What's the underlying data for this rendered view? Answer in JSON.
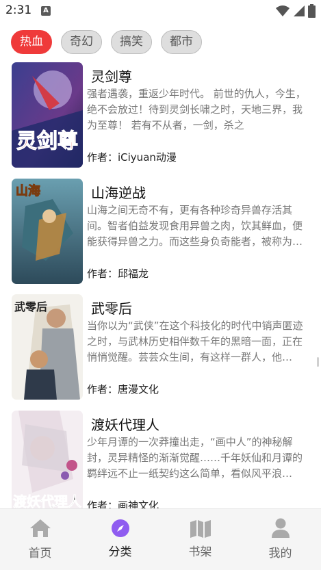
{
  "status_bar": {
    "time": "2:31",
    "notification_badge": "A"
  },
  "categories": [
    {
      "label": "热血",
      "active": true
    },
    {
      "label": "奇幻",
      "active": false
    },
    {
      "label": "搞笑",
      "active": false
    },
    {
      "label": "都市",
      "active": false
    }
  ],
  "comics": [
    {
      "title": "灵剑尊",
      "description": "强者遇袭，重返少年时代。 前世的仇人，今生，绝不会放过！待到灵剑长啸之时，天地三界，我为至尊！ 若有不从者，一剑，杀之",
      "author": "作者：iCiyuan动漫",
      "cover_text": "灵剑尊"
    },
    {
      "title": "山海逆战",
      "description": "山海之间无奇不有，更有各种珍奇异兽存活其间。智者伯益发现食用异兽之肉，饮其鲜血，便能获得异兽之力。而这些身负奇能者，被称为御兽师……",
      "author": "作者：邱福龙",
      "cover_text": "山海"
    },
    {
      "title": "武零后",
      "description": "当你以为“武侠”在这个科技化的时代中销声匿迹之时，与武林历史相伴数千年的黑暗一面，正在悄悄觉醒。芸芸众生间，有这样一群人，他们……",
      "author": "作者：唐漫文化",
      "cover_text": "武零后"
    },
    {
      "title": "渡妖代理人",
      "description": "少年月谭的一次莽撞出走，“画中人”的神秘解封，灵异精怪的渐渐觉醒……千年妖仙和月谭的羁绊远不止一纸契约这么简单，看似风平浪静……",
      "author": "作者：画神文化",
      "cover_text": "渡妖代理人"
    }
  ],
  "bottom_nav": [
    {
      "label": "首页",
      "icon": "home-icon",
      "active": false
    },
    {
      "label": "分类",
      "icon": "compass-icon",
      "active": true
    },
    {
      "label": "书架",
      "icon": "map-icon",
      "active": false
    },
    {
      "label": "我的",
      "icon": "person-icon",
      "active": false
    }
  ],
  "colors": {
    "accent_red": "#ef3a3a",
    "active_nav": "#8f5cf0",
    "inactive_nav": "#aaaaaa"
  }
}
